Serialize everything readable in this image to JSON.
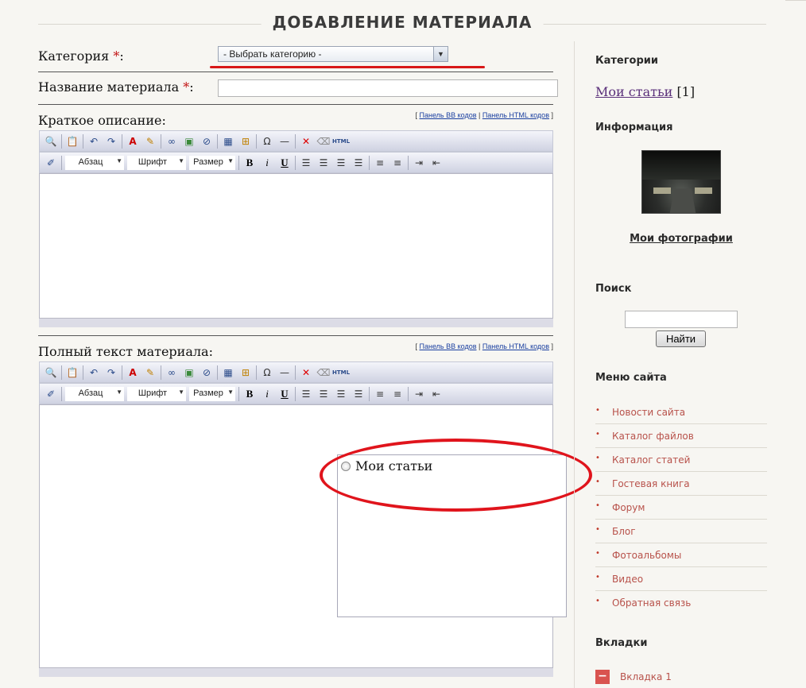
{
  "page": {
    "title": "ДОБАВЛЕНИЕ МАТЕРИАЛА"
  },
  "form": {
    "category_label": "Категория",
    "required_mark": "*",
    "label_colon": ":",
    "category_select_value": "- Выбрать категорию -",
    "name_label": "Название материала",
    "name_value": "",
    "short_desc_label": "Краткое описание:",
    "full_text_label": "Полный текст материала:",
    "panel_links": {
      "open": "[ ",
      "bb": "Панель BB кодов",
      "sep": " | ",
      "html": "Панель HTML кодов",
      "close": " ]"
    }
  },
  "editor_toolbar": {
    "combo_paragraph": "Абзац",
    "combo_font": "Шрифт",
    "combo_size": "Размер",
    "bold": "B",
    "italic": "i",
    "underline": "U",
    "html_label": "HTML"
  },
  "category_popup": {
    "option": "Мои статьи"
  },
  "sidebar": {
    "categories_heading": "Категории",
    "category_link": "Мои статьи",
    "category_count": "[1]",
    "info_heading": "Информация",
    "photos_link": "Мои фотографии",
    "search_heading": "Поиск",
    "search_value": "",
    "search_button": "Найти",
    "menu_heading": "Меню сайта",
    "menu_items": [
      "Новости сайта",
      "Каталог файлов",
      "Каталог статей",
      "Гостевая книга",
      "Форум",
      "Блог",
      "Фотоальбомы",
      "Видео",
      "Обратная связь"
    ],
    "tabs_heading": "Вкладки",
    "tab_item": "Вкладка 1"
  },
  "colors": {
    "required": "#c21414",
    "annotation": "#e0141c",
    "menu_link": "#b8524b",
    "category_link": "#5a2f7a"
  }
}
